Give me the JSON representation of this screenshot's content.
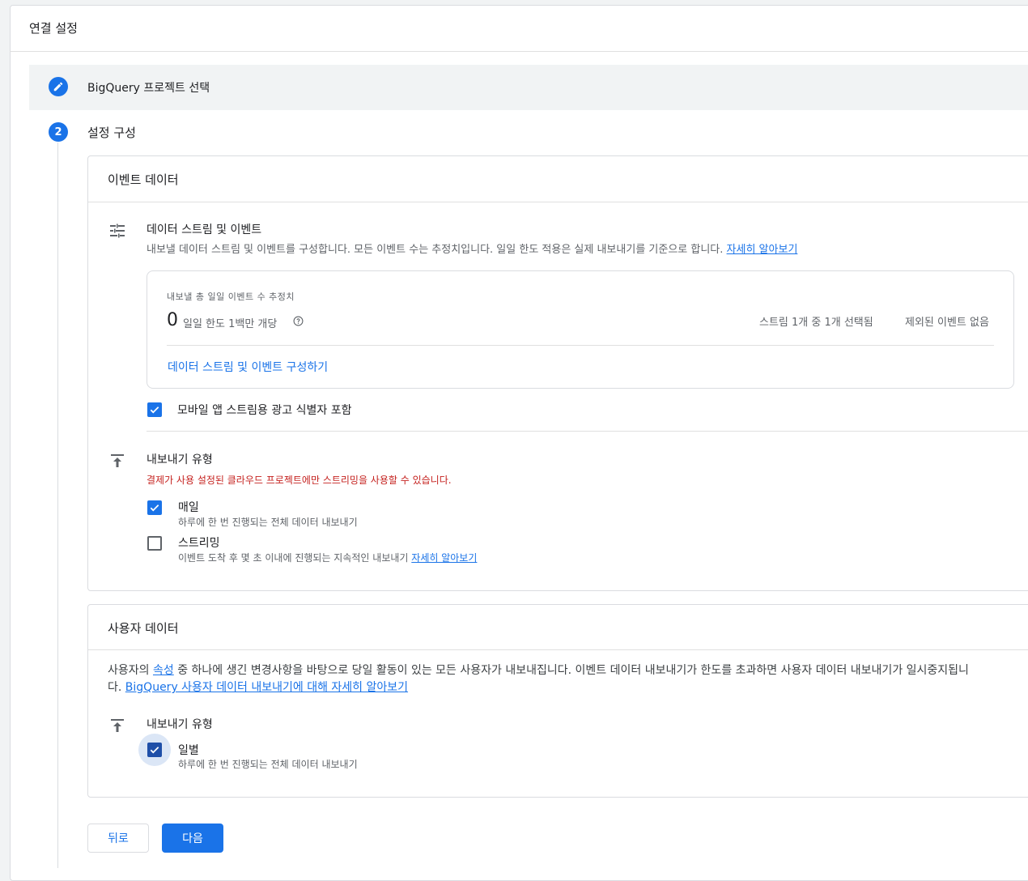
{
  "header": {
    "title": "연결 설정"
  },
  "steps": [
    {
      "number": "",
      "label": "BigQuery 프로젝트 선택",
      "state": "completed"
    },
    {
      "number": "2",
      "label": "설정 구성",
      "state": "active"
    }
  ],
  "event_data": {
    "title": "이벤트 데이터",
    "streams": {
      "title": "데이터 스트림 및 이벤트",
      "description": "내보낼 데이터 스트림 및 이벤트를 구성합니다. 모든 이벤트 수는 추정치입니다. 일일 한도 적용은 실제 내보내기를 기준으로 합니다.",
      "learn_more": "자세히 알아보기",
      "estimate_label": "내보낼 총 일일 이벤트 수 추정치",
      "estimate_value": "0",
      "daily_limit": "일일 한도 1백만 개당",
      "streams_selected": "스트림 1개 중 1개 선택됨",
      "excluded_events": "제외된 이벤트 없음",
      "configure_link": "데이터 스트림 및 이벤트 구성하기"
    },
    "ad_id_checkbox": {
      "label": "모바일 앱 스트림용 광고 식별자 포함",
      "checked": true
    },
    "export_type": {
      "title": "내보내기 유형",
      "warning": "결제가 사용 설정된 클라우드 프로젝트에만 스트리밍을 사용할 수 있습니다.",
      "options": [
        {
          "label": "매일",
          "description": "하루에 한 번 진행되는 전체 데이터 내보내기",
          "checked": true
        },
        {
          "label": "스트리밍",
          "description": "이벤트 도착 후 몇 초 이내에 진행되는 지속적인 내보내기",
          "link": "자세히 알아보기",
          "checked": false
        }
      ]
    }
  },
  "user_data": {
    "title": "사용자 데이터",
    "desc_prefix": "사용자의",
    "desc_link": "속성",
    "desc_middle": "중 하나에 생긴 변경사항을 바탕으로 당일 활동이 있는 모든 사용자가 내보내집니다. 이벤트 데이터 내보내기가 한도를 초과하면 사용자 데이터 내보내기가 일시중지됩니",
    "desc_line2_prefix": "다.",
    "desc_link2": "BigQuery 사용자 데이터 내보내기에 대해 자세히 알아보기",
    "export_type": {
      "title": "내보내기 유형",
      "options": [
        {
          "label": "일별",
          "description": "하루에 한 번 진행되는 전체 데이터 내보내기",
          "checked": true
        }
      ]
    }
  },
  "buttons": {
    "back": "뒤로",
    "next": "다음"
  },
  "colors": {
    "accent": "#1a73e8",
    "warning": "#c5221f",
    "text": "#202124",
    "muted": "#5f6368"
  },
  "icons": [
    "edit-pencil-icon",
    "tune-icon",
    "export-upload-icon",
    "checkmark-icon",
    "help-circle-icon"
  ]
}
